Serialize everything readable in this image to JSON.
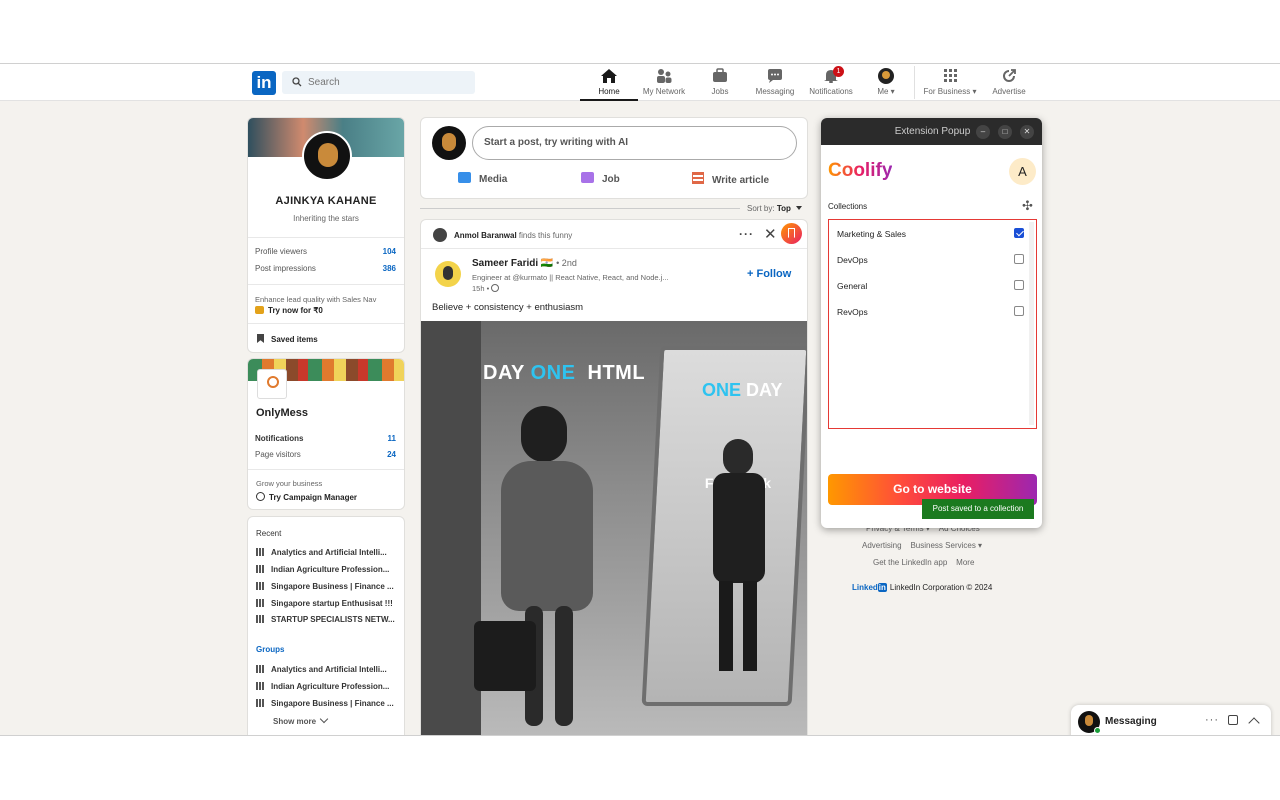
{
  "nav": {
    "search_placeholder": "Search",
    "items": [
      {
        "label": "Home"
      },
      {
        "label": "My Network"
      },
      {
        "label": "Jobs"
      },
      {
        "label": "Messaging"
      },
      {
        "label": "Notifications",
        "badge": "1"
      },
      {
        "label": "Me ▾"
      },
      {
        "label": "For Business ▾"
      },
      {
        "label": "Advertise"
      }
    ]
  },
  "profile": {
    "name": "AJINKYA KAHANE",
    "headline": "Inheriting the stars",
    "stats": [
      {
        "label": "Profile viewers",
        "value": "104"
      },
      {
        "label": "Post impressions",
        "value": "386"
      }
    ],
    "promo_text": "Enhance lead quality with Sales Nav",
    "promo_cta": "Try now for ₹0",
    "saved_items": "Saved items"
  },
  "page_card": {
    "name": "OnlyMess",
    "stats": [
      {
        "label": "Notifications",
        "value": "11"
      },
      {
        "label": "Page visitors",
        "value": "24"
      }
    ],
    "grow_text": "Grow your business",
    "campaign_cta": "Try Campaign Manager"
  },
  "recent": {
    "heading": "Recent",
    "items": [
      "Analytics and Artificial Intelli...",
      "Indian Agriculture Profession...",
      "Singapore Business | Finance ...",
      "Singapore startup Enthusisat !!!",
      "STARTUP SPECIALISTS NETW..."
    ],
    "groups_heading": "Groups",
    "groups": [
      "Analytics and Artificial Intelli...",
      "Indian Agriculture Profession...",
      "Singapore Business | Finance ..."
    ],
    "show_more": "Show more"
  },
  "composer": {
    "placeholder": "Start a post, try writing with AI",
    "actions": [
      "Media",
      "Job",
      "Write article"
    ]
  },
  "sort": {
    "label": "Sort by:",
    "value": "Top"
  },
  "post": {
    "activity_actor": "Anmol Baranwal",
    "activity_text": "finds this funny",
    "author": "Sameer Faridi 🇮🇳",
    "degree": "• 2nd",
    "author_headline": "Engineer at @kurmato || React Native, React, and Node.j...",
    "time": "15h •",
    "follow": "+ Follow",
    "text": "Believe + consistency + enthusiasm",
    "image_text": {
      "day": "DAY",
      "one": "ONE",
      "html": "HTML",
      "one2": "ONE",
      "day2": "DAY",
      "fullstack": "Full Stack",
      "dev": "Dev"
    }
  },
  "popup": {
    "window_title": "Extension Popup",
    "brand": "Coolify",
    "avatar_letter": "A",
    "collections_label": "Collections",
    "collections": [
      {
        "name": "Marketing & Sales",
        "checked": true
      },
      {
        "name": "DevOps",
        "checked": false
      },
      {
        "name": "General",
        "checked": false
      },
      {
        "name": "RevOps",
        "checked": false
      }
    ],
    "go_button": "Go to website",
    "toast": "Post saved to a collection"
  },
  "footer": {
    "line1": [
      "Privacy & Terms ▾",
      "Ad Choices"
    ],
    "line2": [
      "Advertising",
      "Business Services ▾"
    ],
    "line3": [
      "Get the LinkedIn app",
      "More"
    ],
    "brand": "Linked",
    "brand_in": "in",
    "copyright": "LinkedIn Corporation © 2024"
  },
  "messaging": {
    "label": "Messaging"
  },
  "colors": {
    "linkedin_blue": "#0a66c2",
    "toast_green": "#2e7d32",
    "popup_border": "#e53935"
  }
}
